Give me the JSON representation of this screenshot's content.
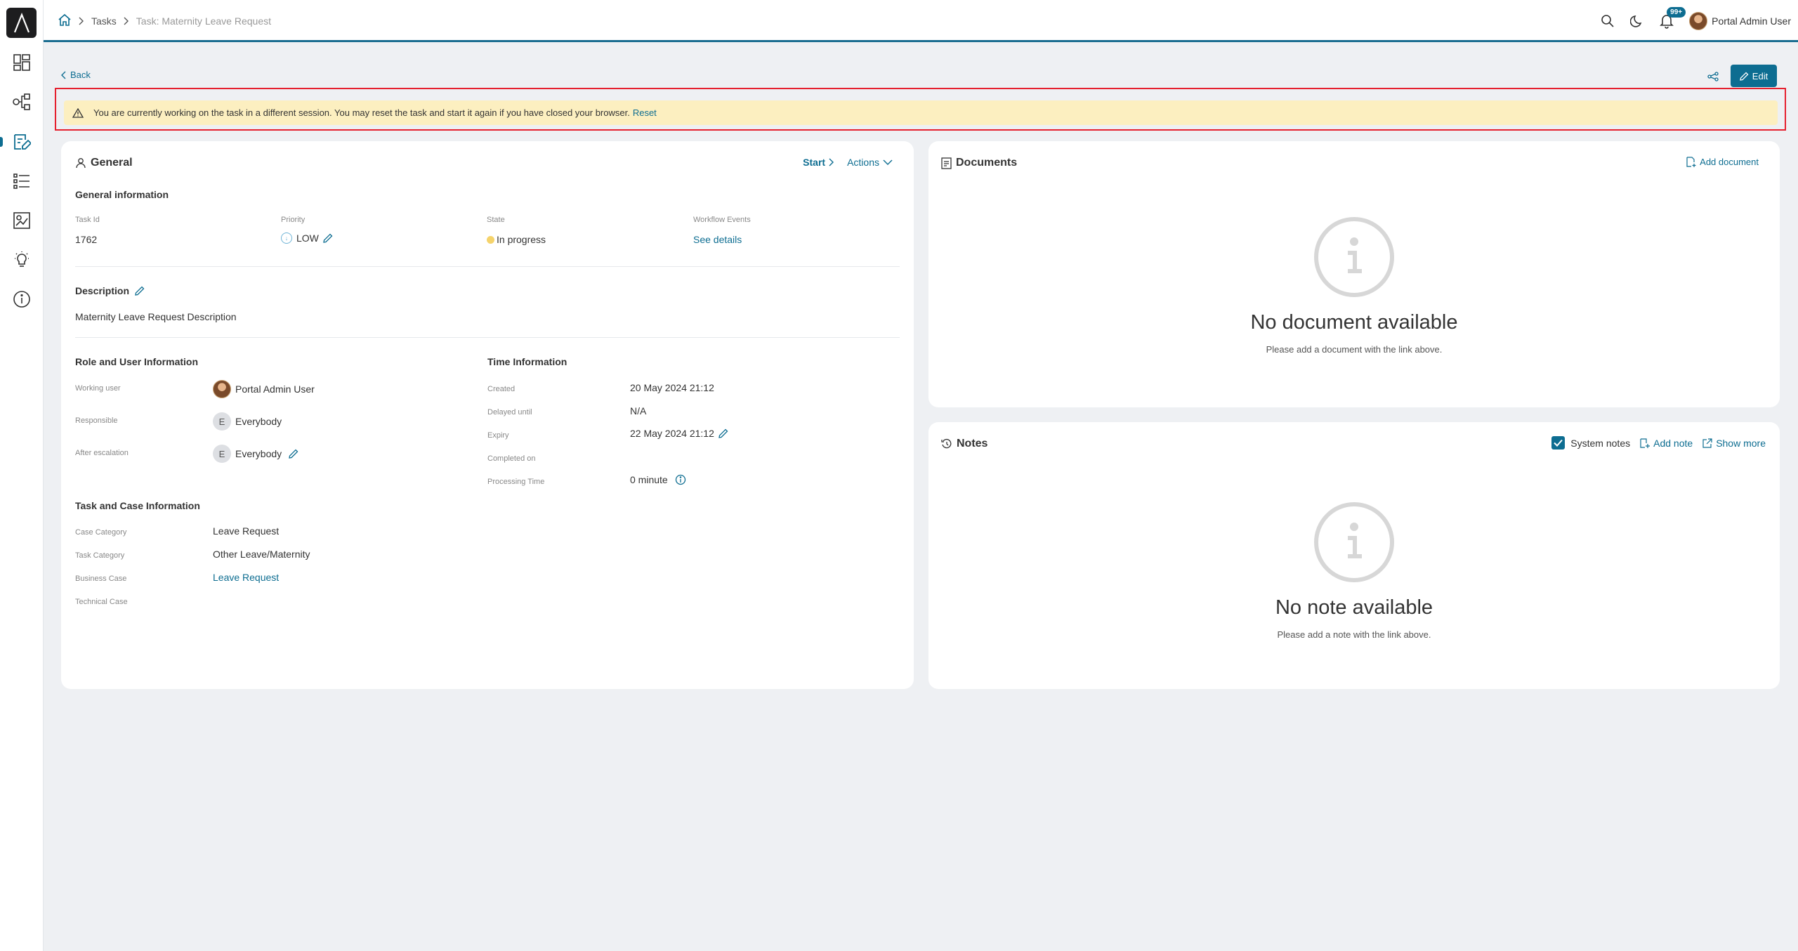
{
  "breadcrumb": {
    "items": [
      "Tasks"
    ],
    "current": "Task: Maternity Leave Request"
  },
  "header": {
    "notifications_badge": "99+",
    "user_name": "Portal Admin User"
  },
  "toolbar": {
    "back_label": "Back",
    "edit_label": "Edit"
  },
  "alert": {
    "message": "You are currently working on the task in a different session. You may reset the task and start it again if you have closed your browser.",
    "action_label": "Reset"
  },
  "general": {
    "title": "General",
    "start_label": "Start",
    "actions_label": "Actions",
    "info_title": "General information",
    "task_id_label": "Task Id",
    "task_id": "1762",
    "priority_label": "Priority",
    "priority": "LOW",
    "state_label": "State",
    "state": "In progress",
    "workflow_label": "Workflow Events",
    "workflow_link": "See details",
    "description_title": "Description",
    "description": "Maternity Leave Request Description",
    "role_title": "Role and User Information",
    "working_user_label": "Working user",
    "working_user": "Portal Admin User",
    "responsible_label": "Responsible",
    "responsible": "Everybody",
    "after_escalation_label": "After escalation",
    "after_escalation": "Everybody",
    "avatar_initial": "E",
    "time_title": "Time Information",
    "created_label": "Created",
    "created": "20 May 2024 21:12",
    "delayed_label": "Delayed until",
    "delayed": "N/A",
    "expiry_label": "Expiry",
    "expiry": "22 May 2024 21:12",
    "completed_label": "Completed on",
    "processing_label": "Processing Time",
    "processing": "0 minute",
    "case_title": "Task and Case Information",
    "case_category_label": "Case Category",
    "case_category": "Leave Request",
    "task_category_label": "Task Category",
    "task_category": "Other Leave/Maternity",
    "business_case_label": "Business Case",
    "business_case": "Leave Request",
    "technical_case_label": "Technical Case"
  },
  "documents": {
    "title": "Documents",
    "add_label": "Add document",
    "empty_title": "No document available",
    "empty_sub": "Please add a document with the link above."
  },
  "notes": {
    "title": "Notes",
    "system_notes_label": "System notes",
    "system_notes_checked": true,
    "add_label": "Add note",
    "show_more_label": "Show more",
    "empty_title": "No note available",
    "empty_sub": "Please add a note with the link above."
  },
  "colors": {
    "accent": "#0d6d91",
    "alert_bg": "#fcefc0",
    "highlight": "#e5202e"
  }
}
